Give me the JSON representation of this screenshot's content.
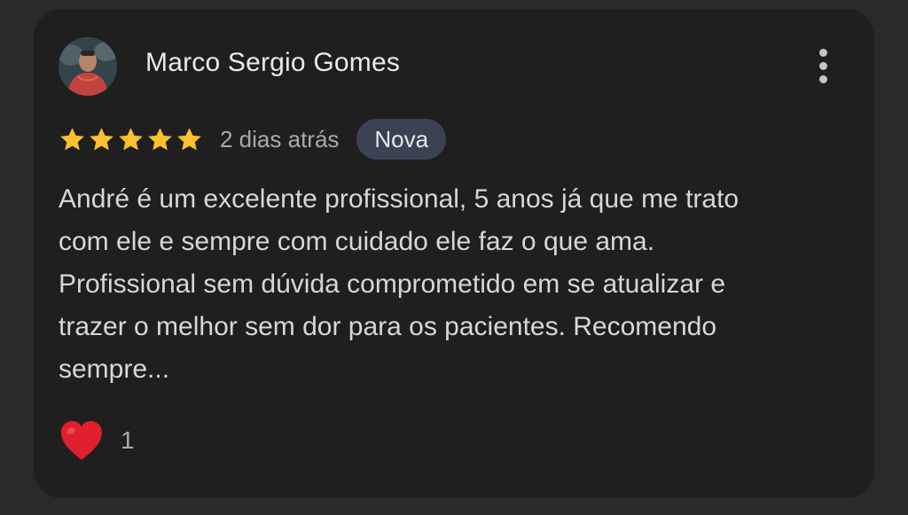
{
  "review": {
    "author": "Marco Sergio Gomes",
    "rating": 5,
    "rating_max": 5,
    "date": "2 dias atrás",
    "badge": "Nova",
    "text": "André é um excelente profissional, 5 anos já que me trato\ncom ele e sempre com cuidado ele faz o que ama.\nProfissional sem dúvida comprometido em se atualizar e\ntrazer o melhor sem dor para os pacientes. Recomendo\nsempre...",
    "reaction": {
      "icon": "heart-icon",
      "count": "1"
    },
    "menu_icon": "more-vert-icon"
  },
  "colors": {
    "background": "#2a2a2c",
    "card": "#1f1f20",
    "star": "#fbc02d",
    "badge_bg": "#3a4253",
    "heart": "#e0202e"
  }
}
